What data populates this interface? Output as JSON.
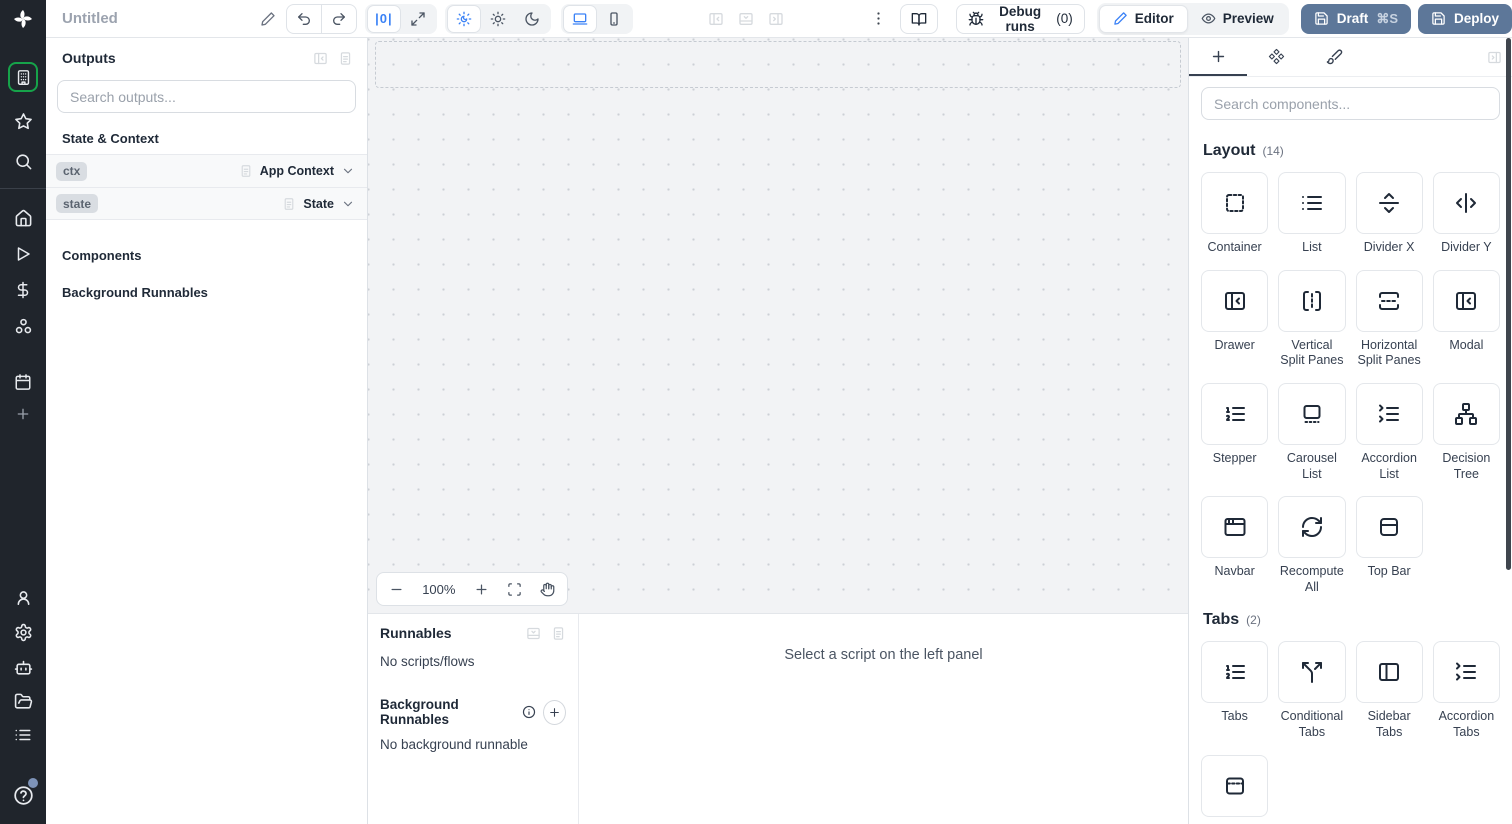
{
  "topbar": {
    "title": "Untitled",
    "zoom_reset": "|0|",
    "debug_runs": "Debug runs",
    "debug_count": "(0)",
    "editor": "Editor",
    "preview": "Preview",
    "draft": "Draft",
    "draft_shortcut": "⌘S",
    "deploy": "Deploy"
  },
  "outputs": {
    "title": "Outputs",
    "search_placeholder": "Search outputs...",
    "state_context_header": "State & Context",
    "components_header": "Components",
    "background_header": "Background Runnables",
    "rows": [
      {
        "badge": "ctx",
        "type": "App Context"
      },
      {
        "badge": "state",
        "type": "State"
      }
    ]
  },
  "canvas": {
    "zoom": "100%"
  },
  "bottom": {
    "runnables_title": "Runnables",
    "no_scripts": "No scripts/flows",
    "background_title": "Background Runnables",
    "no_background": "No background runnable",
    "hint": "Select a script on the left panel"
  },
  "components": {
    "search_placeholder": "Search components...",
    "sections": [
      {
        "title": "Layout",
        "count": "(14)",
        "items": [
          {
            "label": "Container",
            "icon": "container-icon"
          },
          {
            "label": "List",
            "icon": "list-icon"
          },
          {
            "label": "Divider X",
            "icon": "divider-x-icon"
          },
          {
            "label": "Divider Y",
            "icon": "divider-y-icon"
          },
          {
            "label": "Drawer",
            "icon": "drawer-icon"
          },
          {
            "label": "Vertical Split Panes",
            "icon": "vertical-split-icon"
          },
          {
            "label": "Horizontal Split Panes",
            "icon": "horizontal-split-icon"
          },
          {
            "label": "Modal",
            "icon": "modal-icon"
          },
          {
            "label": "Stepper",
            "icon": "stepper-icon"
          },
          {
            "label": "Carousel List",
            "icon": "carousel-icon"
          },
          {
            "label": "Accordion List",
            "icon": "accordion-list-icon"
          },
          {
            "label": "Decision Tree",
            "icon": "decision-tree-icon"
          },
          {
            "label": "Navbar",
            "icon": "navbar-icon"
          },
          {
            "label": "Recompute All",
            "icon": "recompute-icon"
          },
          {
            "label": "Top Bar",
            "icon": "top-bar-icon"
          }
        ]
      },
      {
        "title": "Tabs",
        "count": "(2)",
        "items": [
          {
            "label": "Tabs",
            "icon": "tabs-icon"
          },
          {
            "label": "Conditional Tabs",
            "icon": "conditional-tabs-icon"
          },
          {
            "label": "Sidebar Tabs",
            "icon": "sidebar-tabs-icon"
          },
          {
            "label": "Accordion Tabs",
            "icon": "accordion-tabs-icon"
          },
          {
            "label": "",
            "icon": "window-dashed-icon"
          }
        ]
      }
    ]
  },
  "colors": {
    "accent_blue": "#3b82f6",
    "active_green": "#16a34a",
    "deploy_slate": "#5d7799",
    "rail_background": "#20252c"
  }
}
